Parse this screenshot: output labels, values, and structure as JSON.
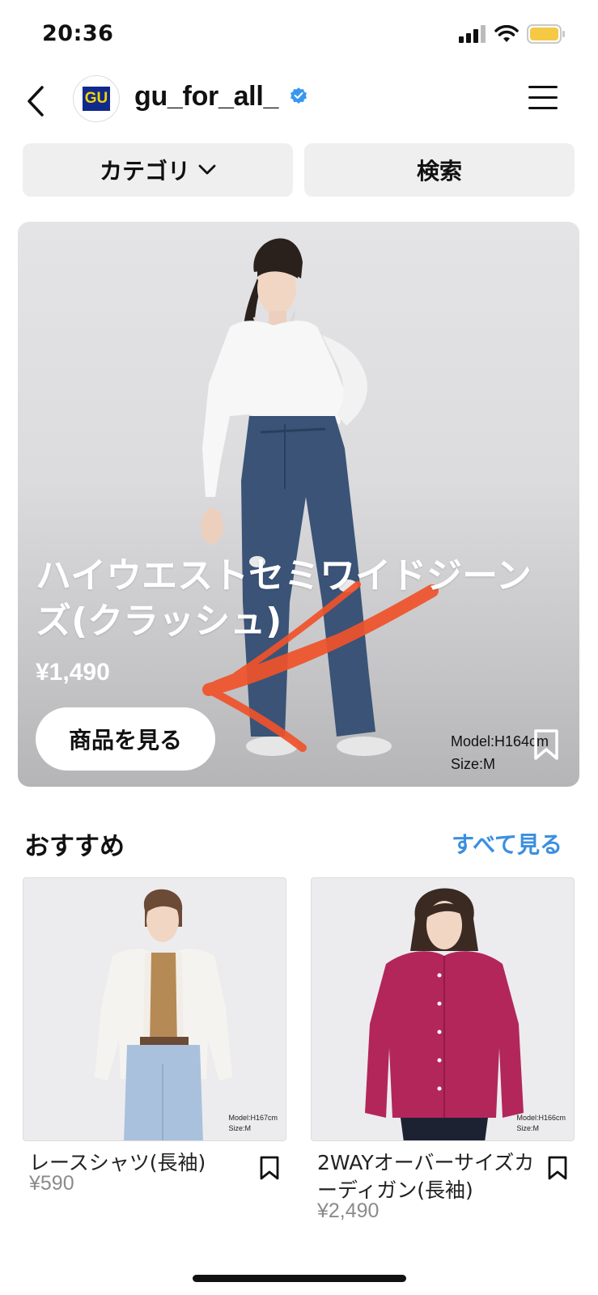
{
  "status_bar": {
    "time": "20:36"
  },
  "header": {
    "account_name": "gu_for_all_",
    "avatar_text": "GU"
  },
  "filters": {
    "category_label": "カテゴリ",
    "search_label": "検索"
  },
  "hero": {
    "title": "ハイウエストセミワイドジーンズ(クラッシュ)",
    "price": "¥1,490",
    "cta_label": "商品を見る",
    "model_line1": "Model:H164cm",
    "model_line2": "Size:M"
  },
  "recommended": {
    "title": "おすすめ",
    "see_all_label": "すべて見る",
    "items": [
      {
        "name": "レースシャツ(長袖)",
        "price": "¥590",
        "model_line1": "Model:H167cm",
        "model_line2": "Size:M"
      },
      {
        "name": "2WAYオーバーサイズカーディガン(長袖)",
        "price": "¥2,490",
        "model_line1": "Model:H166cm",
        "model_line2": "Size:M"
      }
    ]
  },
  "colors": {
    "link_blue": "#3b8fe0",
    "verified_blue": "#3897f0",
    "annotation_red": "#f0522a",
    "brand_navy": "#10298c",
    "brand_yellow": "#f4d400"
  },
  "icons": [
    "back-arrow-icon",
    "verified-badge-icon",
    "hamburger-menu-icon",
    "chevron-down-icon",
    "bookmark-icon",
    "signal-icon",
    "wifi-icon",
    "battery-icon"
  ]
}
